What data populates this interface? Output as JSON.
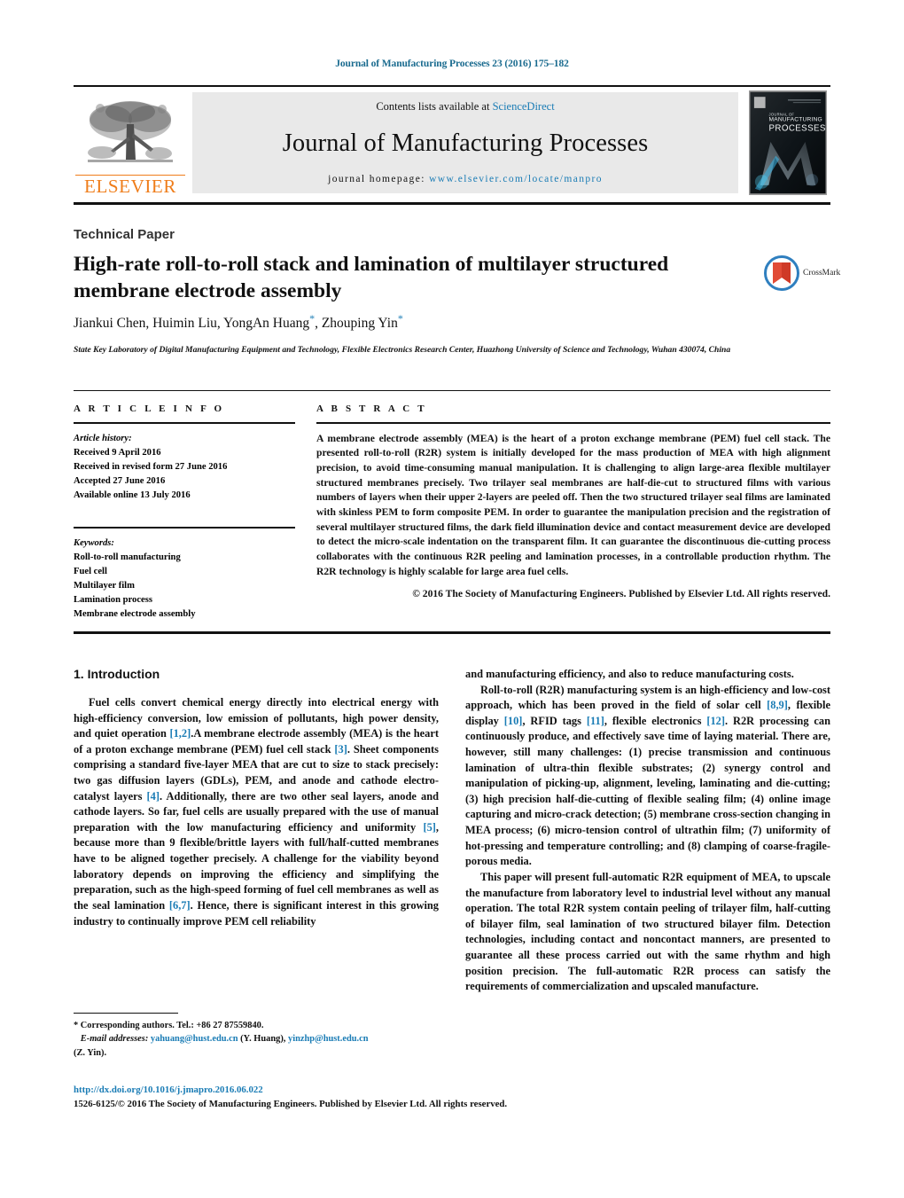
{
  "running_head": "Journal of Manufacturing Processes 23 (2016) 175–182",
  "masthead": {
    "contents_prefix": "Contents lists available at ",
    "sciencedirect": "ScienceDirect",
    "journal_title": "Journal of Manufacturing Processes",
    "homepage_prefix": "journal homepage: ",
    "homepage_url": "www.elsevier.com/locate/manpro",
    "elsevier_wordmark": "ELSEVIER",
    "cover_title_small": "JOURNAL OF",
    "cover_title_line1": "MANUFACTURING",
    "cover_title_line2": "PROCESSES",
    "colors": {
      "link": "#1a7cb5",
      "elsevier_orange": "#ef7d1a",
      "band_gray": "#e9e9e9"
    }
  },
  "article": {
    "type_label": "Technical Paper",
    "title": "High-rate roll-to-roll stack and lamination of multilayer structured membrane electrode assembly",
    "authors": "Jiankui Chen, Huimin Liu, YongAn Huang",
    "authors_tail": ", Zhouping Yin",
    "affiliation": "State Key Laboratory of Digital Manufacturing Equipment and Technology, Flexible Electronics Research Center, Huazhong University of Science and Technology, Wuhan 430074, China",
    "crossmark_label": "CrossMark"
  },
  "article_info": {
    "heading": "A R T I C L E    I N F O",
    "history_label": "Article history:",
    "history": [
      "Received 9 April 2016",
      "Received in revised form 27 June 2016",
      "Accepted 27 June 2016",
      "Available online 13 July 2016"
    ],
    "keywords_label": "Keywords:",
    "keywords": [
      "Roll-to-roll manufacturing",
      "Fuel cell",
      "Multilayer film",
      "Lamination process",
      "Membrane electrode assembly"
    ]
  },
  "abstract": {
    "heading": "A B S T R A C T",
    "text": "A membrane electrode assembly (MEA) is the heart of a proton exchange membrane (PEM) fuel cell stack. The presented roll-to-roll (R2R) system is initially developed for the mass production of MEA with high alignment precision, to avoid time-consuming manual manipulation. It is challenging to align large-area flexible multilayer structured membranes precisely. Two trilayer seal membranes are half-die-cut to structured films with various numbers of layers when their upper 2-layers are peeled off. Then the two structured trilayer seal films are laminated with skinless PEM to form composite PEM. In order to guarantee the manipulation precision and the registration of several multilayer structured films, the dark field illumination device and contact measurement device are developed to detect the micro-scale indentation on the transparent film. It can guarantee the discontinuous die-cutting process collaborates with the continuous R2R peeling and lamination processes, in a controllable production rhythm. The R2R technology is highly scalable for large area fuel cells.",
    "copyright": "© 2016 The Society of Manufacturing Engineers. Published by Elsevier Ltd. All rights reserved."
  },
  "introduction": {
    "heading": "1.  Introduction",
    "left_paragraphs": [
      {
        "segments": [
          {
            "t": "Fuel cells convert chemical energy directly into electrical energy with high-efficiency conversion, low emission of pollutants, high power density, and quiet operation "
          },
          {
            "t": "[1,2]",
            "ref": true
          },
          {
            "t": ".A membrane electrode assembly (MEA) is the heart of a proton exchange membrane (PEM) fuel cell stack "
          },
          {
            "t": "[3]",
            "ref": true
          },
          {
            "t": ". Sheet components comprising a standard five-layer MEA that are cut to size to stack precisely: two gas diffusion layers (GDLs), PEM, and anode and cathode electro-catalyst layers "
          },
          {
            "t": "[4]",
            "ref": true
          },
          {
            "t": ". Additionally, there are two other seal layers, anode and cathode layers. So far, fuel cells are usually prepared with the use of manual preparation with the low manufacturing efficiency and uniformity "
          },
          {
            "t": "[5]",
            "ref": true
          },
          {
            "t": ", because more than 9 flexible/brittle layers with full/half-cutted membranes have to be aligned together precisely. A challenge for the viability beyond laboratory depends on improving the efficiency and simplifying the preparation, such as the high-speed forming of fuel cell membranes as well as the seal lamination "
          },
          {
            "t": "[6,7]",
            "ref": true
          },
          {
            "t": ". Hence, there is significant interest in this growing industry to continually improve PEM cell reliability"
          }
        ]
      }
    ],
    "right_paragraphs": [
      {
        "segments": [
          {
            "t": "and manufacturing efficiency, and also to reduce manufacturing costs."
          }
        ],
        "no_indent": true
      },
      {
        "segments": [
          {
            "t": "Roll-to-roll (R2R) manufacturing system is an high-efficiency and low-cost approach, which has been proved in the field of solar cell "
          },
          {
            "t": "[8,9]",
            "ref": true
          },
          {
            "t": ", flexible display "
          },
          {
            "t": "[10]",
            "ref": true
          },
          {
            "t": ", RFID tags "
          },
          {
            "t": "[11]",
            "ref": true
          },
          {
            "t": ", flexible electronics "
          },
          {
            "t": "[12]",
            "ref": true
          },
          {
            "t": ". R2R processing can continuously produce, and effectively save time of laying material. There are, however, still many challenges: (1) precise transmission and continuous lamination of ultra-thin flexible substrates; (2) synergy control and manipulation of picking-up, alignment, leveling, laminating and die-cutting; (3) high precision half-die-cutting of flexible sealing film; (4) online image capturing and micro-crack detection; (5) membrane cross-section changing in MEA process; (6) micro-tension control of ultrathin film; (7) uniformity of hot-pressing and temperature controlling; and (8) clamping of coarse-fragile-porous media."
          }
        ]
      },
      {
        "segments": [
          {
            "t": "This paper will present full-automatic R2R equipment of MEA, to upscale the manufacture from laboratory level to industrial level without any manual operation. The total R2R system contain peeling of trilayer film, half-cutting of bilayer film, seal lamination of two structured bilayer film. Detection technologies, including contact and noncontact manners, are presented to guarantee all these process carried out with the same rhythm and high position precision. The full-automatic R2R process can satisfy the requirements of commercialization and upscaled manufacture."
          }
        ]
      }
    ]
  },
  "footnote": {
    "corresponding": "* Corresponding authors. Tel.: +86 27 87559840.",
    "email_label": "E-mail addresses:",
    "email1": "yahuang@hust.edu.cn",
    "email1_owner": " (Y. Huang), ",
    "email2": "yinzhp@hust.edu.cn",
    "email2_owner": "(Z. Yin)."
  },
  "footer": {
    "doi": "http://dx.doi.org/10.1016/j.jmapro.2016.06.022",
    "copyright": "1526-6125/© 2016 The Society of Manufacturing Engineers. Published by Elsevier Ltd. All rights reserved."
  }
}
